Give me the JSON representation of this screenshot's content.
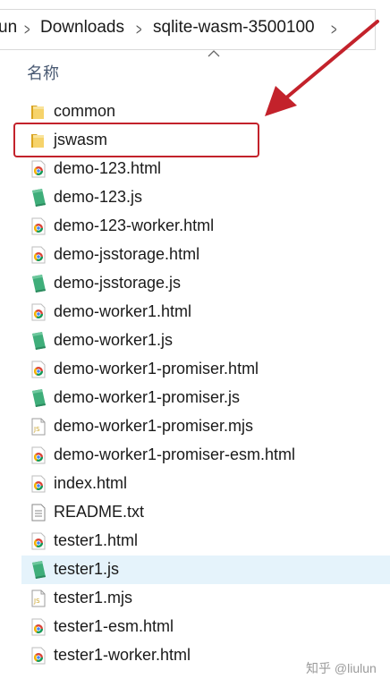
{
  "breadcrumb": {
    "items": [
      "un",
      "Downloads",
      "sqlite-wasm-3500100"
    ]
  },
  "column_header": {
    "name": "名称"
  },
  "files": [
    {
      "name": "common",
      "type": "folder",
      "selected": false
    },
    {
      "name": "jswasm",
      "type": "folder",
      "selected": false
    },
    {
      "name": "demo-123.html",
      "type": "html",
      "selected": false
    },
    {
      "name": "demo-123.js",
      "type": "js",
      "selected": false
    },
    {
      "name": "demo-123-worker.html",
      "type": "html",
      "selected": false
    },
    {
      "name": "demo-jsstorage.html",
      "type": "html",
      "selected": false
    },
    {
      "name": "demo-jsstorage.js",
      "type": "js",
      "selected": false
    },
    {
      "name": "demo-worker1.html",
      "type": "html",
      "selected": false
    },
    {
      "name": "demo-worker1.js",
      "type": "js",
      "selected": false
    },
    {
      "name": "demo-worker1-promiser.html",
      "type": "html",
      "selected": false
    },
    {
      "name": "demo-worker1-promiser.js",
      "type": "js",
      "selected": false
    },
    {
      "name": "demo-worker1-promiser.mjs",
      "type": "mjs",
      "selected": false
    },
    {
      "name": "demo-worker1-promiser-esm.html",
      "type": "html",
      "selected": false
    },
    {
      "name": "index.html",
      "type": "html",
      "selected": false
    },
    {
      "name": "README.txt",
      "type": "txt",
      "selected": false
    },
    {
      "name": "tester1.html",
      "type": "html",
      "selected": false
    },
    {
      "name": "tester1.js",
      "type": "js",
      "selected": true
    },
    {
      "name": "tester1.mjs",
      "type": "mjs",
      "selected": false
    },
    {
      "name": "tester1-esm.html",
      "type": "html",
      "selected": false
    },
    {
      "name": "tester1-worker.html",
      "type": "html",
      "selected": false
    }
  ],
  "annotation": {
    "highlight_color": "#c3222b",
    "highlighted_item": "jswasm"
  },
  "watermark": {
    "text": "知乎 @liulun"
  },
  "colors": {
    "selection": "#e5f3fb",
    "folder": "#f4c64e",
    "js_icon": "#3fae7a"
  }
}
